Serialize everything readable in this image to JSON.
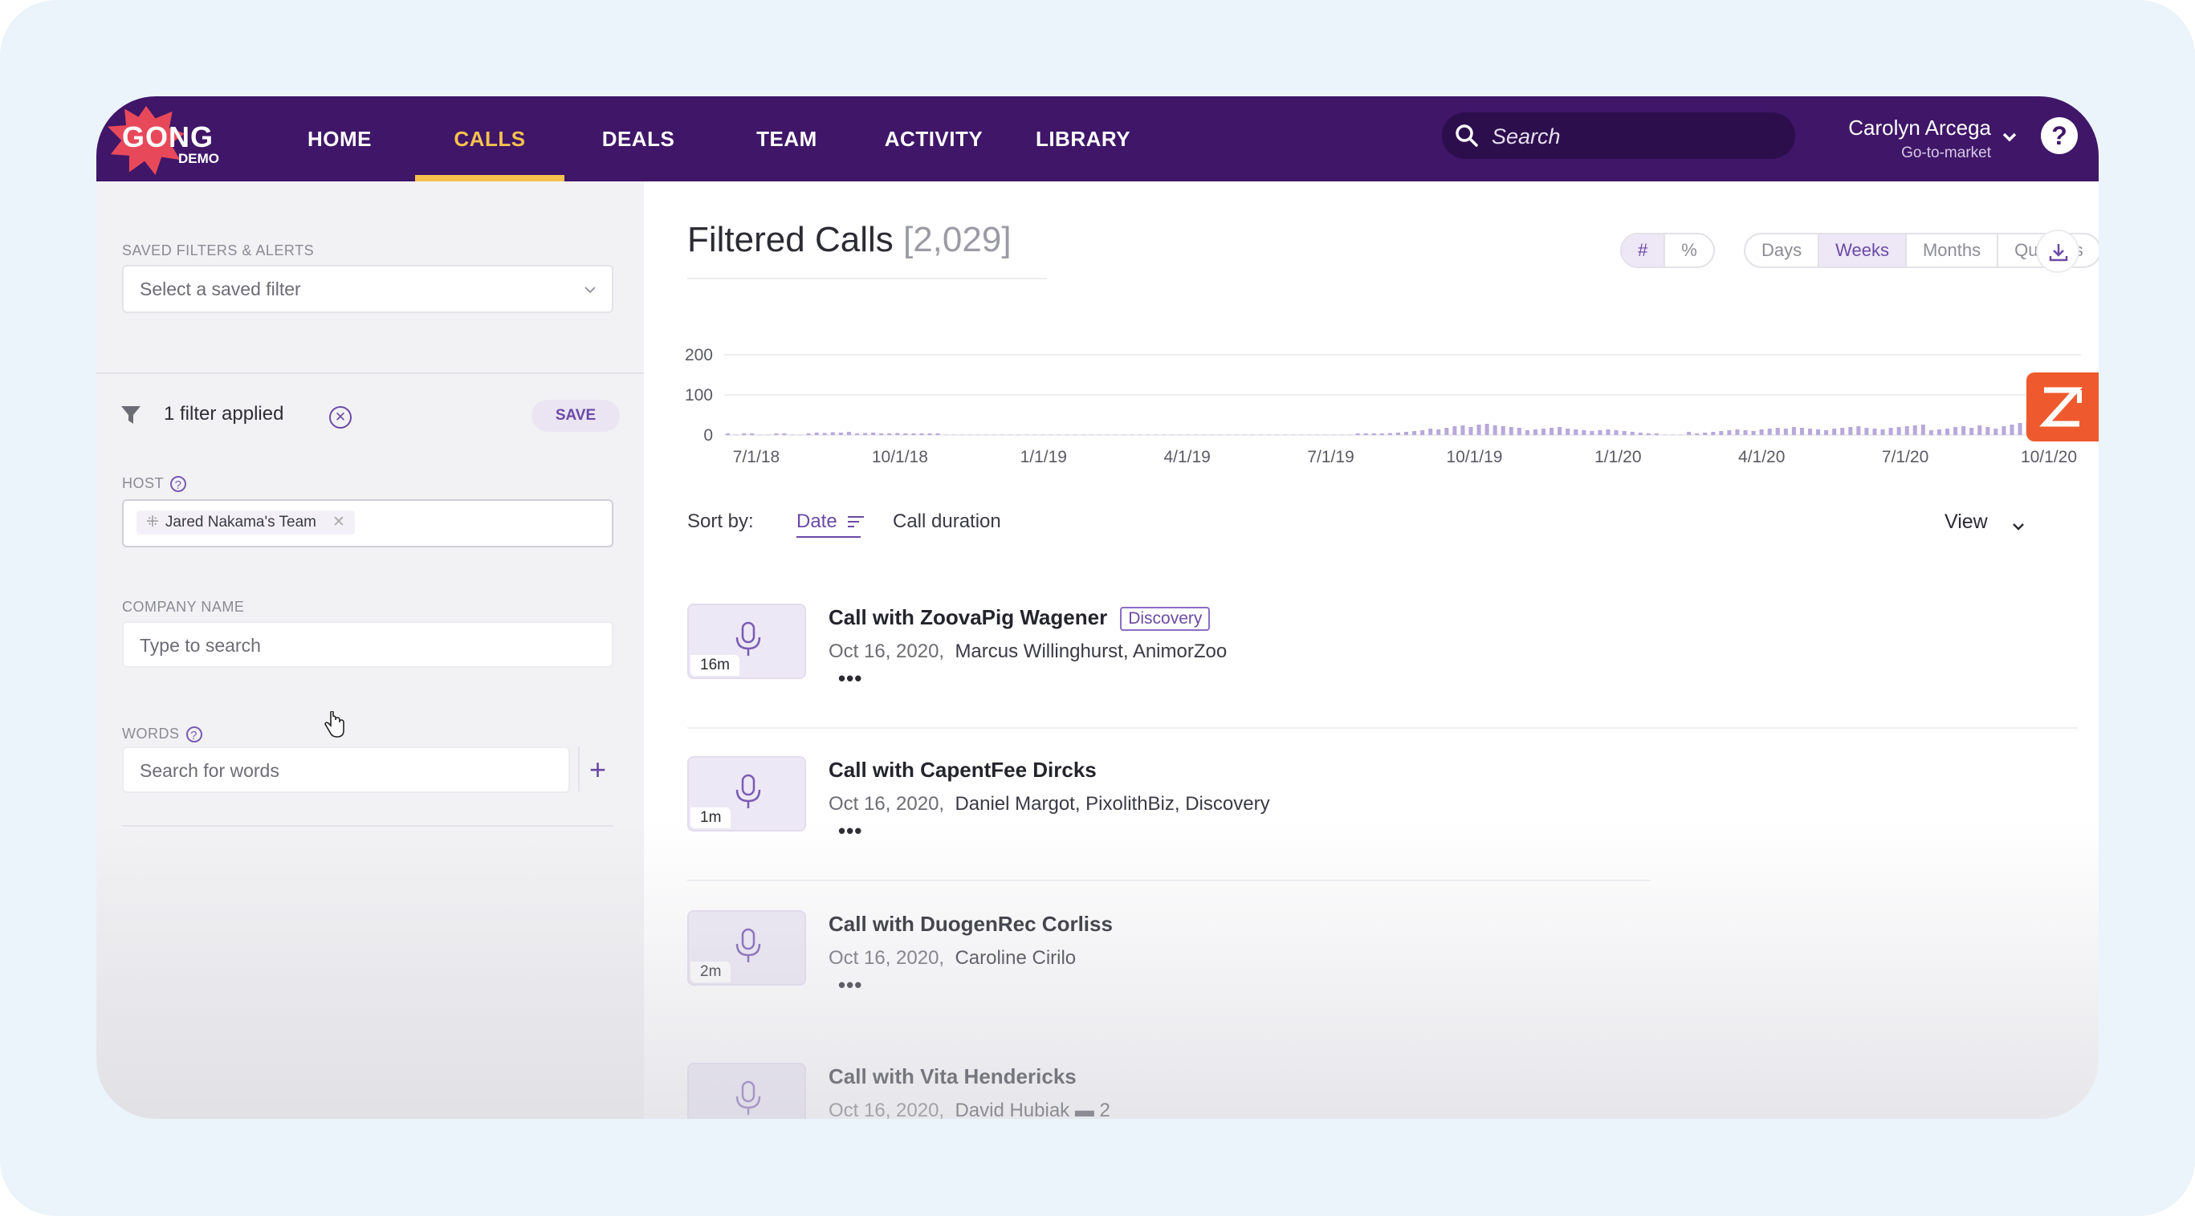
{
  "brand": {
    "logo_text": "GONG",
    "logo_sub": "DEMO"
  },
  "nav": {
    "items": [
      {
        "label": "HOME"
      },
      {
        "label": "CALLS"
      },
      {
        "label": "DEALS"
      },
      {
        "label": "TEAM"
      },
      {
        "label": "ACTIVITY"
      },
      {
        "label": "LIBRARY"
      }
    ],
    "active": "CALLS",
    "search_placeholder": "Search",
    "user_name": "Carolyn Arcega",
    "user_role": "Go-to-market",
    "help": "?"
  },
  "sidebar": {
    "saved_filters_label": "SAVED FILTERS & ALERTS",
    "saved_filter_placeholder": "Select a saved filter",
    "filters_applied": "1 filter applied",
    "save_label": "SAVE",
    "host_label": "HOST",
    "host_chip": "Jared Nakama's Team",
    "company_label": "COMPANY NAME",
    "company_placeholder": "Type to search",
    "words_label": "WORDS",
    "words_placeholder": "Search for words"
  },
  "main": {
    "title": "Filtered Calls",
    "count": "[2,029]",
    "metric_toggle": [
      "#",
      "%"
    ],
    "metric_active": "#",
    "period_toggle": [
      "Days",
      "Weeks",
      "Months",
      "Quarters"
    ],
    "period_active": "Weeks",
    "sort_label": "Sort by:",
    "sort_date": "Date",
    "sort_duration": "Call duration",
    "view_label": "View"
  },
  "chart_data": {
    "type": "bar",
    "y_ticks": [
      "200",
      "100",
      "0"
    ],
    "ylim": [
      0,
      200
    ],
    "x_ticks": [
      "7/1/18",
      "10/1/18",
      "1/1/19",
      "4/1/19",
      "7/1/19",
      "10/1/19",
      "1/1/20",
      "4/1/20",
      "7/1/20",
      "10/1/20"
    ],
    "values": [
      2,
      0,
      1,
      3,
      0,
      0,
      2,
      1,
      0,
      0,
      4,
      6,
      5,
      7,
      6,
      8,
      4,
      5,
      6,
      3,
      4,
      5,
      4,
      3,
      2,
      3,
      2,
      0,
      0,
      0,
      0,
      0,
      0,
      0,
      0,
      0,
      0,
      0,
      0,
      0,
      0,
      0,
      0,
      0,
      0,
      0,
      0,
      0,
      0,
      0,
      0,
      0,
      0,
      0,
      0,
      0,
      0,
      0,
      0,
      0,
      0,
      0,
      0,
      0,
      0,
      0,
      0,
      0,
      0,
      0,
      0,
      0,
      0,
      0,
      0,
      0,
      0,
      0,
      1,
      2,
      3,
      4,
      5,
      6,
      8,
      10,
      12,
      16,
      14,
      18,
      22,
      24,
      20,
      26,
      28,
      24,
      22,
      20,
      18,
      12,
      14,
      16,
      18,
      20,
      16,
      14,
      12,
      10,
      12,
      14,
      12,
      10,
      8,
      6,
      4,
      2,
      0,
      0,
      0,
      8,
      4,
      6,
      8,
      10,
      12,
      14,
      12,
      10,
      14,
      16,
      18,
      16,
      20,
      18,
      16,
      14,
      12,
      16,
      18,
      20,
      22,
      18,
      16,
      14,
      18,
      20,
      22,
      24,
      26,
      12,
      14,
      16,
      20,
      22,
      18,
      24,
      20,
      16,
      22,
      26,
      30,
      34,
      38,
      46,
      60,
      80,
      52,
      40
    ]
  },
  "calls": [
    {
      "duration": "16m",
      "title": "Call with ZoovaPig Wagener",
      "tag": "Discovery",
      "date": "Oct 16, 2020,",
      "people": "Marcus Willinghurst,  AnimorZoo",
      "more": "•••"
    },
    {
      "duration": "1m",
      "title": "Call with CapentFee Dircks",
      "tag": "",
      "date": "Oct 16, 2020,",
      "people": "Daniel Margot,  PixolithBiz,  Discovery",
      "more": "•••"
    },
    {
      "duration": "2m",
      "title": "Call with DuogenRec Corliss",
      "tag": "",
      "date": "Oct 16, 2020,",
      "people": "Caroline Cirilo",
      "more": "•••"
    },
    {
      "duration": "",
      "title": "Call with Vita Hendericks",
      "tag": "",
      "date": "Oct 16, 2020,",
      "people": "David Hubiak   ▬ 2",
      "more": ""
    }
  ],
  "colors": {
    "nav_bg": "#3f1668",
    "accent": "#6b4aa6",
    "active_tab": "#f6c24d",
    "brand_red": "#e8495a",
    "zendesk": "#ee5a2e"
  }
}
